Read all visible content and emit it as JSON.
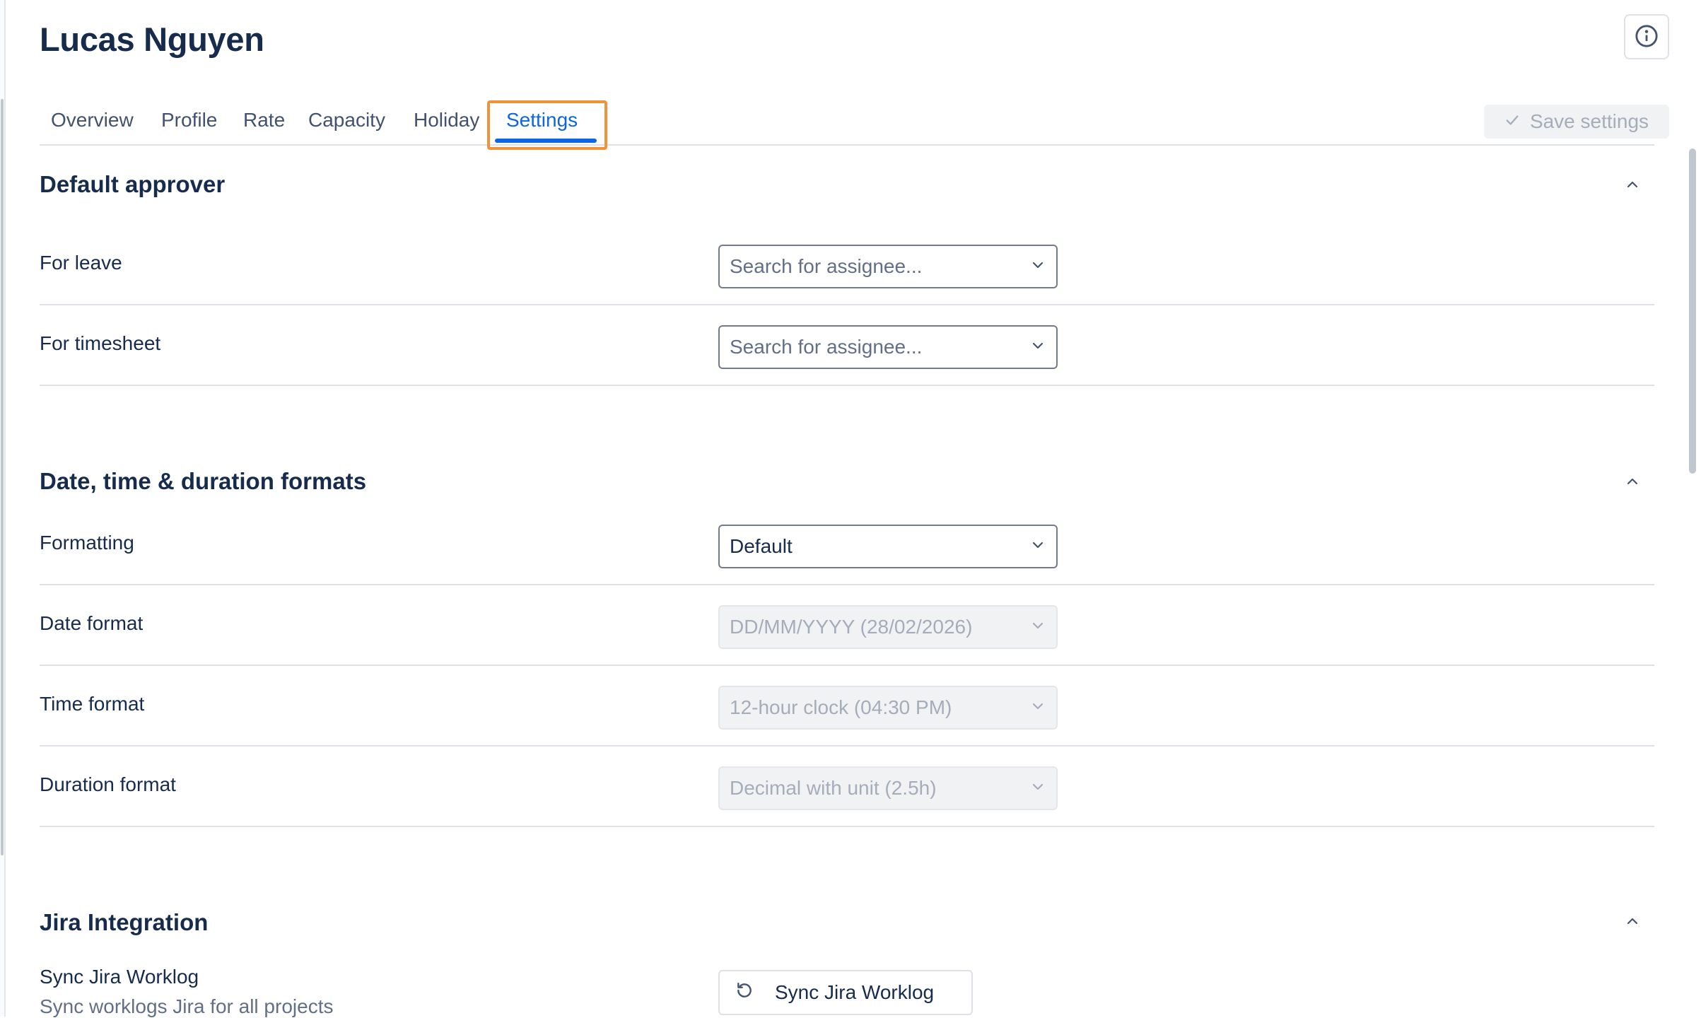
{
  "header": {
    "title": "Lucas Nguyen"
  },
  "tabs": [
    {
      "label": "Overview"
    },
    {
      "label": "Profile"
    },
    {
      "label": "Rate"
    },
    {
      "label": "Capacity"
    },
    {
      "label": "Holiday"
    },
    {
      "label": "Settings",
      "active": true
    }
  ],
  "toolbar": {
    "save_label": "Save settings"
  },
  "sections": {
    "default_approver": {
      "title": "Default approver",
      "rows": [
        {
          "label": "For leave",
          "placeholder": "Search for assignee..."
        },
        {
          "label": "For timesheet",
          "placeholder": "Search for assignee..."
        }
      ]
    },
    "formats": {
      "title": "Date, time & duration formats",
      "rows": [
        {
          "label": "Formatting",
          "value": "Default"
        },
        {
          "label": "Date format",
          "value": "DD/MM/YYYY (28/02/2026)"
        },
        {
          "label": "Time format",
          "value": "12-hour clock (04:30 PM)"
        },
        {
          "label": "Duration format",
          "value": "Decimal with unit (2.5h)"
        }
      ]
    },
    "jira": {
      "title": "Jira Integration",
      "sync_label": "Sync Jira Worklog",
      "sync_description": "Sync worklogs Jira for all projects",
      "sync_button": "Sync Jira Worklog"
    }
  },
  "icons": {
    "info": "info-icon",
    "check": "check-icon",
    "chevron_down": "chevron-down-icon",
    "chevron_up": "chevron-up-icon",
    "refresh": "refresh-icon"
  },
  "colors": {
    "accent": "#0c66e4",
    "highlight": "#f1923a",
    "text": "#172b4d",
    "border": "#dfe1e6"
  }
}
